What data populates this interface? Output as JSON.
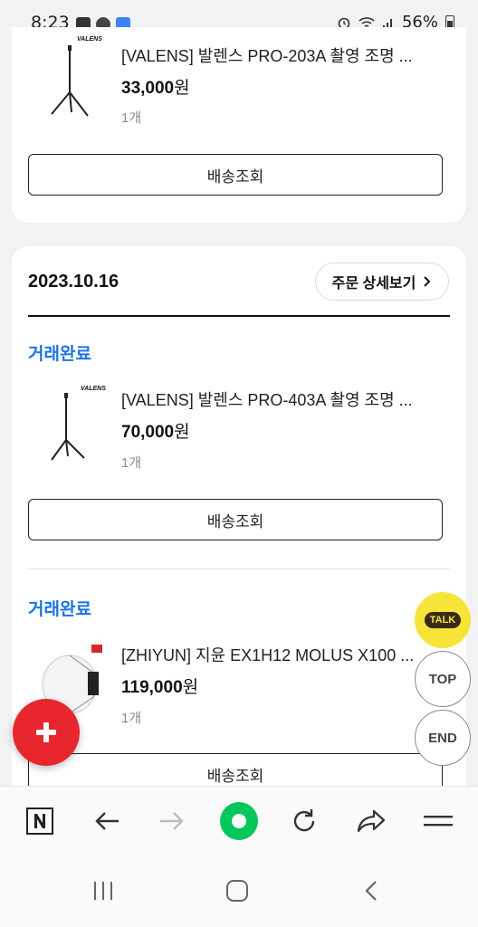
{
  "status_bar": {
    "time": "8:23",
    "battery": "56%"
  },
  "orders": [
    {
      "items": [
        {
          "name": "[VALENS] 발렌스 PRO-203A 촬영 조명 ...",
          "price": "33,000",
          "currency": "원",
          "quantity": "1개",
          "brand_logo": "VALENS",
          "ship_button": "배송조회"
        }
      ]
    },
    {
      "date": "2023.10.16",
      "detail_button": "주문 상세보기",
      "items": [
        {
          "status": "거래완료",
          "name": "[VALENS] 발렌스 PRO-403A 촬영 조명 ...",
          "price": "70,000",
          "currency": "원",
          "quantity": "1개",
          "brand_logo": "VALENS",
          "ship_button": "배송조회"
        },
        {
          "status": "거래완료",
          "name": "[ZHIYUN] 지윤 EX1H12 MOLUS X100 ...",
          "price": "119,000",
          "currency": "원",
          "quantity": "1개",
          "ship_button": "배송조회"
        }
      ]
    }
  ],
  "floating": {
    "talk_label": "TALK",
    "top_label": "TOP",
    "end_label": "END"
  },
  "colors": {
    "status_blue": "#1a73e8",
    "fab_red": "#e8262e",
    "talk_yellow": "#f6e43a",
    "naver_green": "#03c75a"
  },
  "browser_toolbar": {
    "icons": [
      "naver-n-icon",
      "back-arrow-icon",
      "forward-arrow-icon",
      "home-green-icon",
      "refresh-icon",
      "share-icon",
      "menu-icon"
    ]
  }
}
